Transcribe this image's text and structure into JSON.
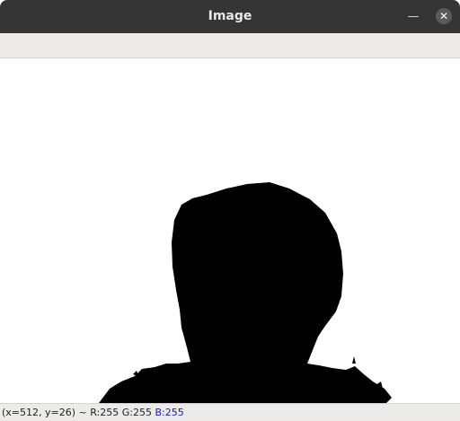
{
  "window": {
    "title": "Image",
    "minimize_glyph": "—",
    "close_glyph": "✕"
  },
  "status": {
    "coords": "(x=512, y=26) ~",
    "r": "R:255",
    "g": "G:255",
    "b": "B:255"
  },
  "colors": {
    "titlebar": "#353535",
    "toolbar": "#edebe9",
    "silhouette": "#000000",
    "background": "#ffffff"
  }
}
